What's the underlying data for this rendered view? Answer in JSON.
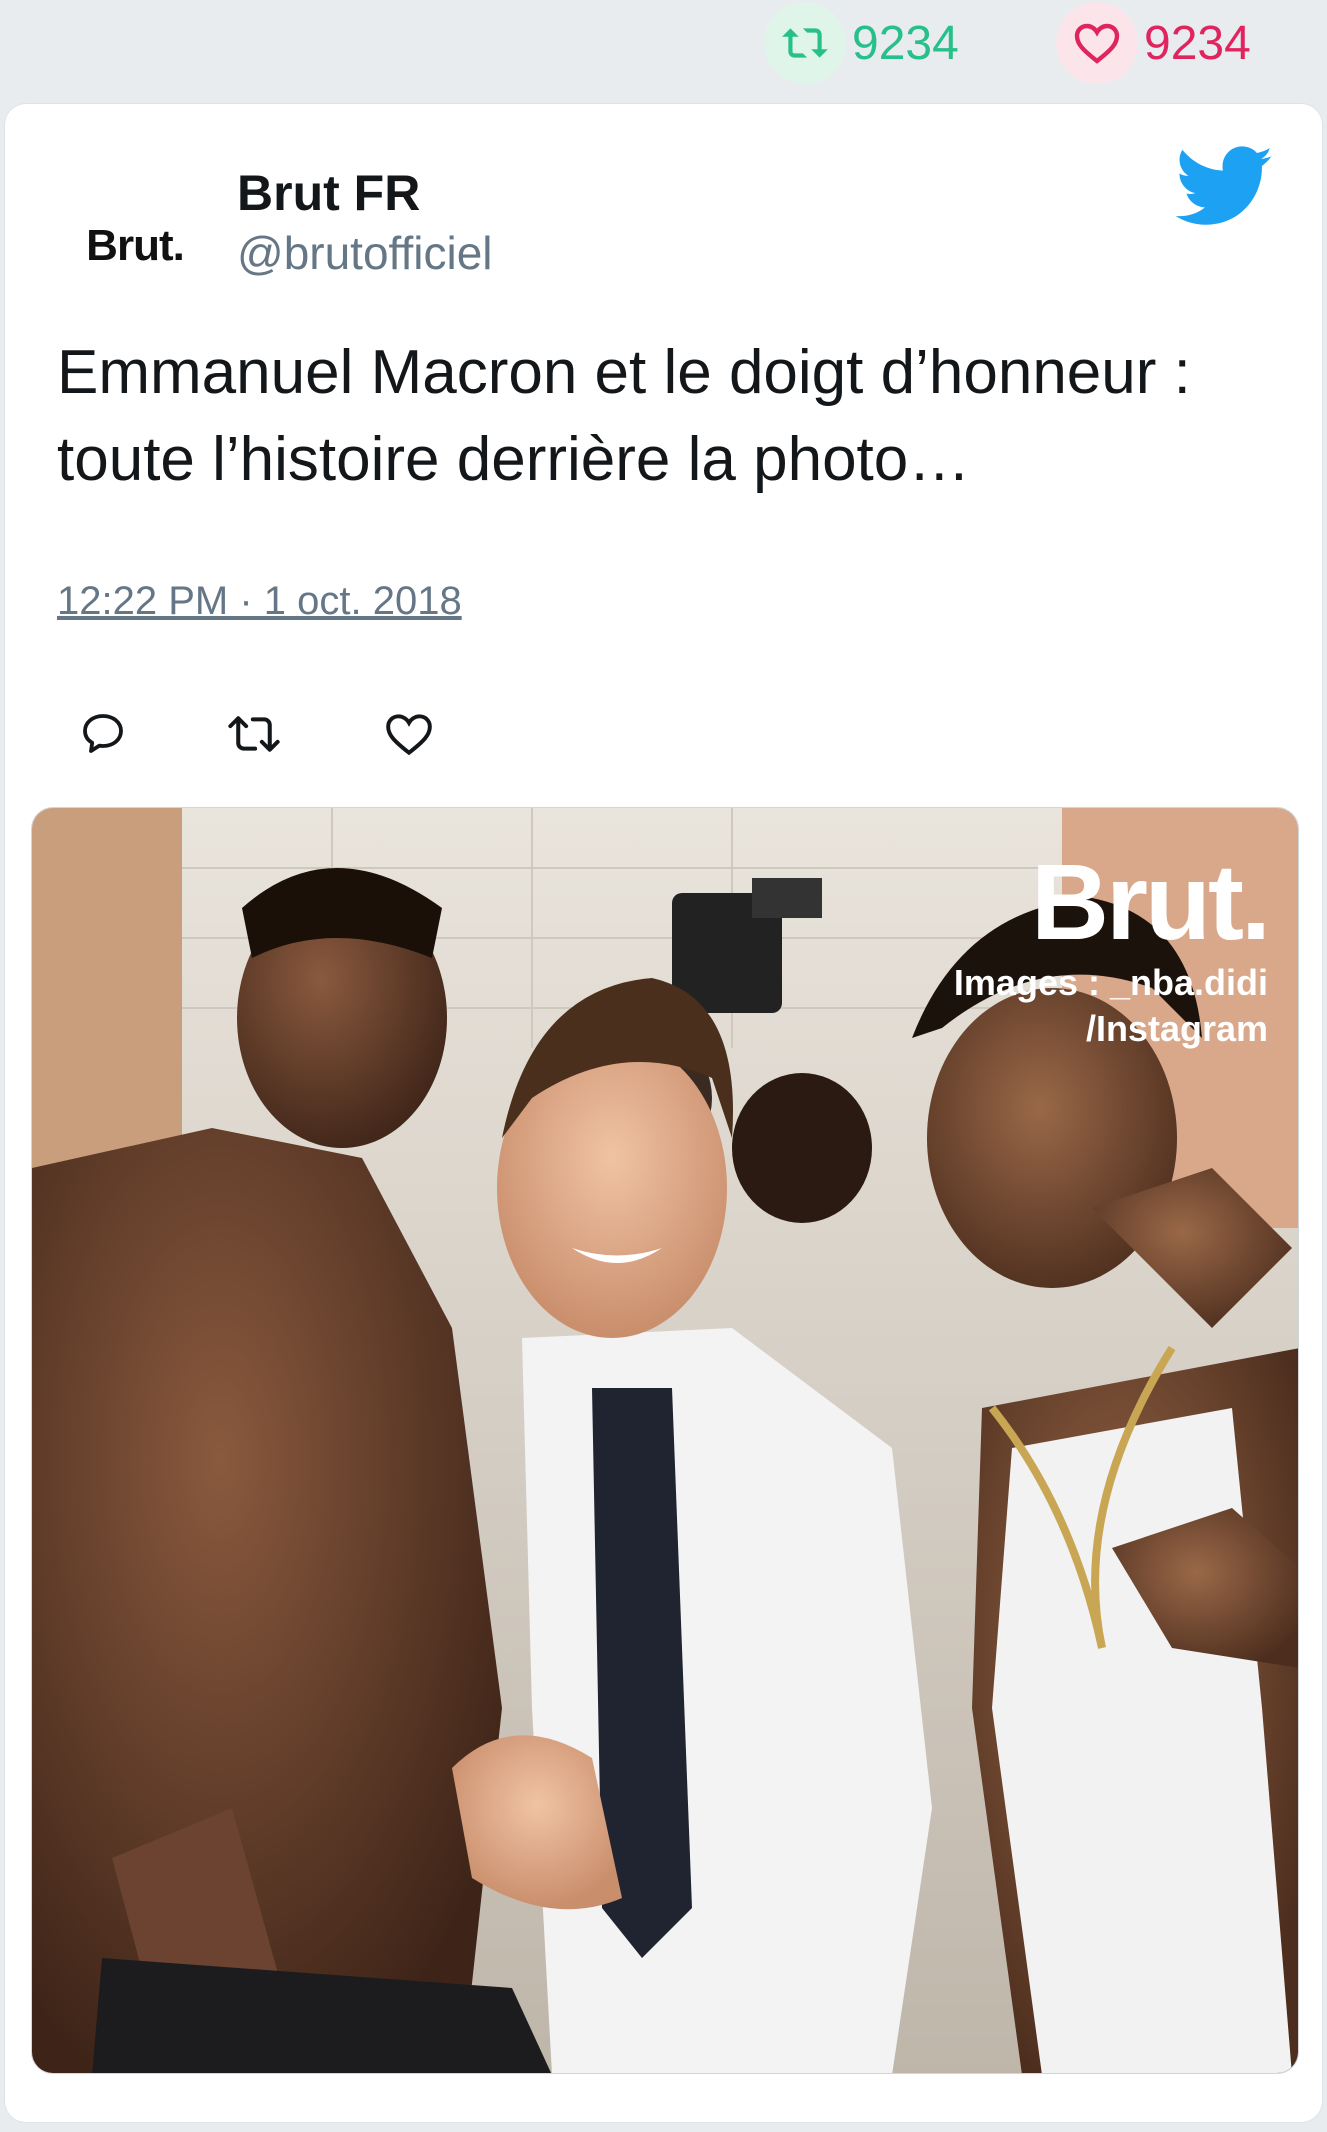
{
  "top_stats": {
    "retweets": "9234",
    "likes": "9234",
    "retweet_icon": "retweet-icon",
    "like_icon": "heart-icon"
  },
  "tweet": {
    "avatar_text": "Brut.",
    "display_name": "Brut FR",
    "handle": "@brutofficiel",
    "text": "Emmanuel Macron et le doigt d’honneur : toute l’histoire derrière la photo…",
    "timestamp": "12:22 PM · 1 oct. 2018",
    "platform_icon": "twitter-bird-icon",
    "actions": [
      "reply-icon",
      "retweet-icon",
      "heart-icon"
    ]
  },
  "media": {
    "watermark_logo": "Brut.",
    "watermark_credit_line1": "Images : _nba.didi",
    "watermark_credit_line2": "/Instagram"
  },
  "colors": {
    "background": "#e9ecef",
    "retweet_green": "#28c08a",
    "like_pink": "#e0245e",
    "twitter_blue": "#1da1f2",
    "muted_text": "#657786"
  }
}
